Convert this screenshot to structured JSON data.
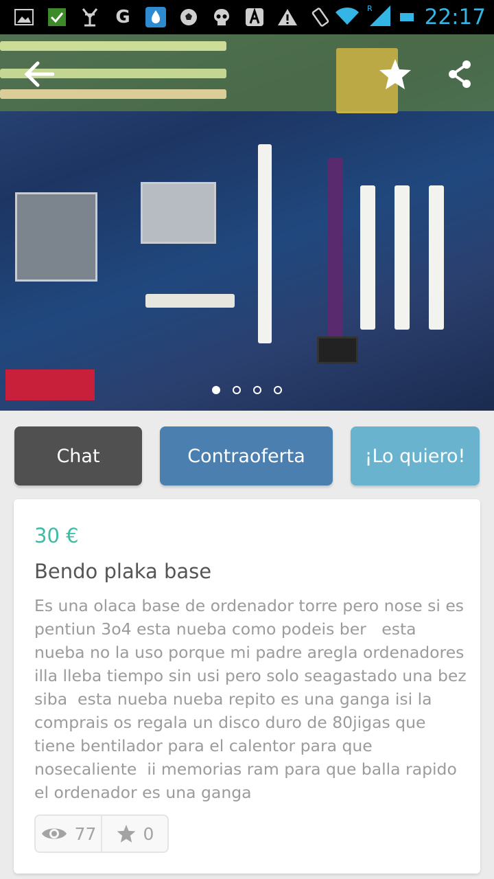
{
  "status_bar": {
    "icons": [
      "image-icon",
      "checkbox-icon",
      "bug-icon",
      "g-icon",
      "water-drop-icon",
      "soccer-ball-icon",
      "skull-icon",
      "a-icon",
      "warning-icon",
      "rotate-icon",
      "wifi-icon",
      "signal-icon",
      "battery-icon"
    ],
    "time": "22:17",
    "time_color": "#33b5e5"
  },
  "hero": {
    "page_count": 4,
    "active_page": 1
  },
  "actions": {
    "chat_label": "Chat",
    "offer_label": "Contraoferta",
    "want_label": "¡Lo quiero!"
  },
  "item": {
    "price": "30 €",
    "title": "Bendo plaka base",
    "description": "Es una olaca base de ordenador torre pero nose si es pentiun 3o4 esta nueba como podeis ber   esta nueba no la uso porque mi padre aregla ordenadores illa lleba tiempo sin usi pero solo seagastado una bez siba  esta nueba nueba repito es una ganga isi la comprais os regala un disco duro de 80jigas que tiene bentilador para el calentor para que nosecaliente  ii memorias ram para que balla rapido el ordenador es una ganga",
    "views": "77",
    "favorites": "0"
  },
  "colors": {
    "price": "#3cbca5",
    "chat_button": "#505050",
    "offer_button": "#4a7fb0",
    "want_button": "#6ab3cf"
  }
}
